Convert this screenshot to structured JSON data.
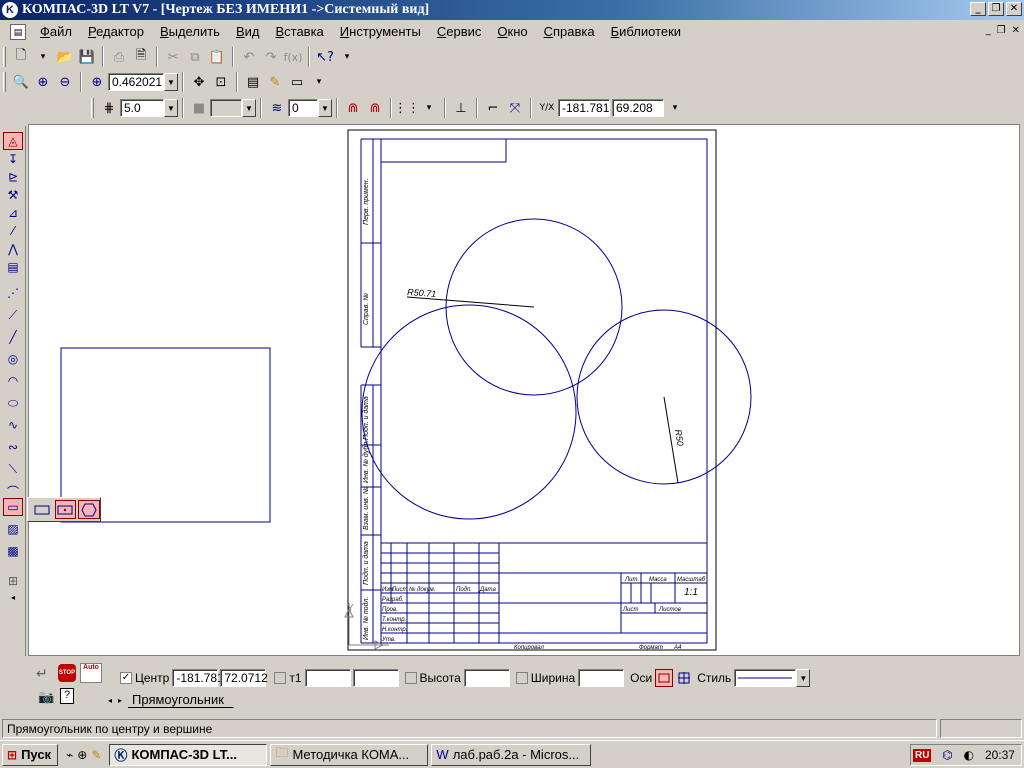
{
  "window": {
    "title": "КОМПАС-3D LT V7 - [Чертеж БЕЗ ИМЕНИ1 ->Системный вид]",
    "app_icon_glyph": "K"
  },
  "menu": {
    "items": [
      "Файл",
      "Редактор",
      "Выделить",
      "Вид",
      "Вставка",
      "Инструменты",
      "Сервис",
      "Окно",
      "Справка",
      "Библиотеки"
    ]
  },
  "view_toolbar": {
    "zoom_value": "0.462021"
  },
  "format_toolbar": {
    "step_value": "5.0",
    "layer_value": "0",
    "coord_x": "-181.781",
    "coord_y": "69.208"
  },
  "drawing": {
    "radius_label_1": "R50.71",
    "radius_label_2": "R50",
    "stamp_cells": {
      "izm": "Изм.",
      "list": "Лист",
      "ndokum": "№ докум.",
      "podp": "Подп.",
      "data": "Дата",
      "razrab": "Разраб.",
      "prov": "Пров.",
      "tkontr": "Т.контр.",
      "nkontr": "Н.контр.",
      "utv": "Утв.",
      "lit": "Лит.",
      "massa": "Масса",
      "masshtab": "Масштаб",
      "scale_value": "1:1",
      "list2": "Лист",
      "listov": "Листов",
      "kopiroval": "Копировал",
      "format": "Формат",
      "format_value": "A4"
    },
    "side_labels": [
      "Перв. примен.",
      "Справ. №",
      "Подп. и дата",
      "Инв. № дубл.",
      "Взам. инв. №",
      "Подп. и дата",
      "Инв. № подл."
    ]
  },
  "params": {
    "center_label": "Центр",
    "center_x": "-181.781",
    "center_y": "72.0712",
    "t1_label": "т1",
    "t1_x": "",
    "t1_y": "",
    "height_label": "Высота",
    "height_value": "",
    "width_label": "Ширина",
    "width_value": "",
    "axes_label": "Оси",
    "style_label": "Стиль",
    "tab_label": "Прямоугольник",
    "auto_label": "Auto",
    "stop_label": "STOP"
  },
  "status": {
    "message": "Прямоугольник по центру и вершине"
  },
  "taskbar": {
    "start_label": "Пуск",
    "tasks": [
      "КОМПАС-3D LT...",
      "Методичка КОМА...",
      "лаб.раб.2а - Micros..."
    ],
    "lang": "RU",
    "clock": "20:37"
  },
  "colors": {
    "geometry": "#00008b",
    "title_start": "#0a246a",
    "active_tool": "#f5b5b5"
  }
}
